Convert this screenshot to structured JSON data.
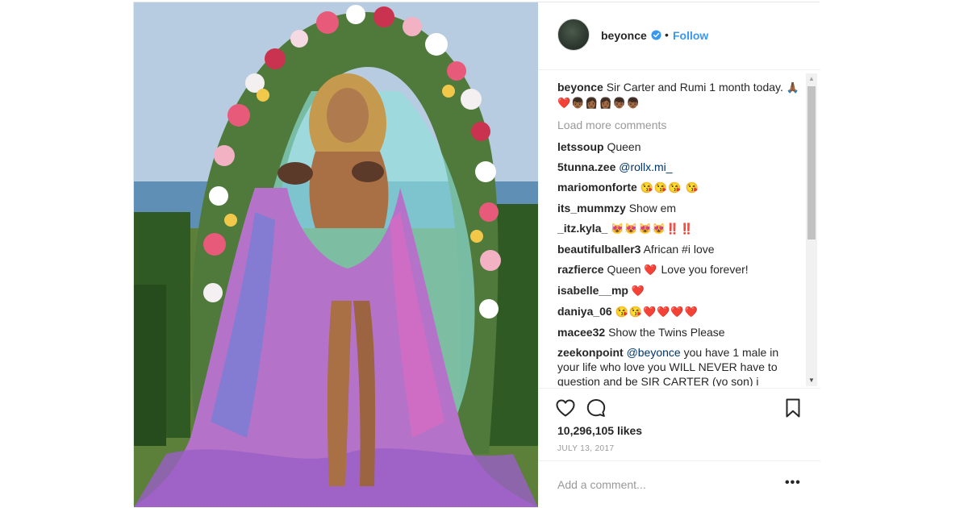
{
  "post": {
    "author": {
      "username": "beyonce",
      "verified": true,
      "follow_label": "Follow",
      "separator": "•"
    },
    "caption": {
      "username": "beyonce",
      "text": "Sir Carter and Rumi 1 month today.",
      "emojis": "🙏🏾❤️👦🏾👩🏾👩🏾👦🏾👦🏾"
    },
    "load_more_label": "Load more comments",
    "comments": [
      {
        "username": "letssoup",
        "text": "Queen",
        "mention": "",
        "emojis": ""
      },
      {
        "username": "5tunna.zee",
        "text": "",
        "mention": "@rollx.mi_",
        "emojis": ""
      },
      {
        "username": "mariomonforte",
        "text": "",
        "mention": "",
        "emojis": "😘😘😘 😘"
      },
      {
        "username": "its_mummzy",
        "text": "Show em",
        "mention": "",
        "emojis": ""
      },
      {
        "username": "_itz.kyla_",
        "text": "",
        "mention": "",
        "emojis": "😻😻😻😻‼️‼️"
      },
      {
        "username": "beautifulballer3",
        "text": "African #i love",
        "mention": "",
        "emojis": ""
      },
      {
        "username": "razfierce",
        "text": "Queen",
        "mention": "",
        "emojis": "❤️",
        "text2": "Love you forever!"
      },
      {
        "username": "isabelle__mp",
        "text": "",
        "mention": "",
        "emojis": "❤️"
      },
      {
        "username": "daniya_06",
        "text": "",
        "mention": "",
        "emojis": "😘😘❤️❤️❤️❤️"
      },
      {
        "username": "macee32",
        "text": "Show the Twins Please",
        "mention": "",
        "emojis": ""
      },
      {
        "username": "zeekonpoint",
        "text": "you have 1 male in your life who love you WILL NEVER have to question and be SIR CARTER (yo son) i",
        "mention": "@beyonce",
        "emojis": ""
      }
    ],
    "likes": "10,296,105 likes",
    "date": "JULY 13, 2017",
    "add_comment_placeholder": "Add a comment...",
    "more_label": "•••"
  },
  "icons": [
    "heart-icon",
    "comment-icon",
    "bookmark-icon",
    "verified-icon",
    "more-options-icon"
  ],
  "colors": {
    "link": "#3897f0",
    "verified": "#3897f0",
    "muted": "#999999",
    "text": "#262626",
    "border": "#efefef"
  }
}
